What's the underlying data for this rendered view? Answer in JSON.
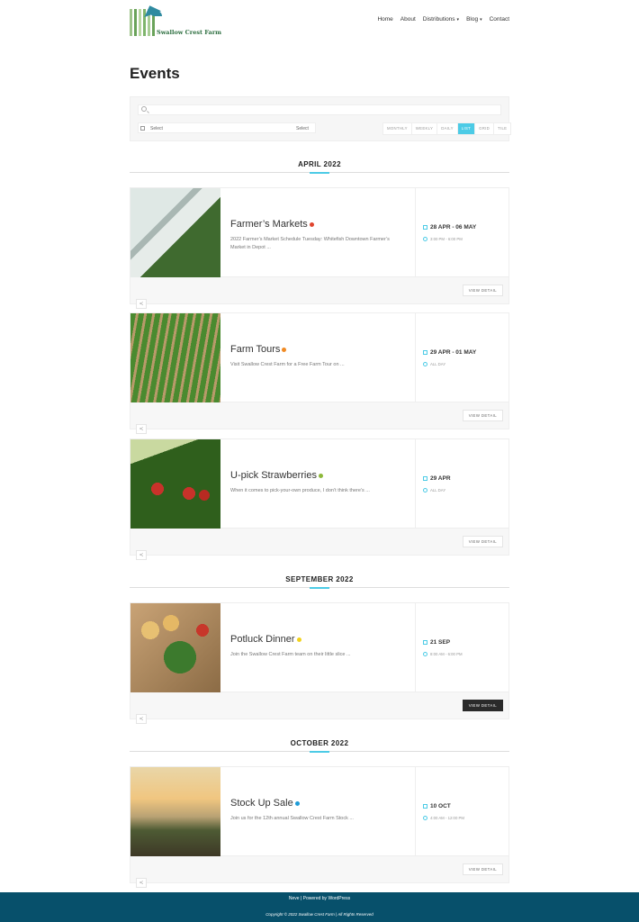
{
  "logo": {
    "text": "Swallow Crest Farm"
  },
  "nav": {
    "items": [
      "Home",
      "About",
      "Distributions",
      "Blog",
      "Contact"
    ]
  },
  "page": {
    "title": "Events"
  },
  "filter": {
    "select_label": "Select",
    "select_value": "Select",
    "views": [
      "MONTHLY",
      "WEEKLY",
      "DAILY",
      "LIST",
      "GRID",
      "TILE"
    ],
    "active_view": "LIST"
  },
  "months": [
    "APRIL 2022",
    "SEPTEMBER 2022",
    "OCTOBER 2022"
  ],
  "events": [
    {
      "title": "Farmer’s Markets",
      "dot_color": "#e0442e",
      "desc": "2022 Farmer’s Market Schedule Tuesday: Whitefish Downtown Farmer’s Market in Depot ...",
      "date": "28 APR - 06 MAY",
      "time": "3:00 PM - 6:00 PM",
      "button": "VIEW DETAIL"
    },
    {
      "title": "Farm Tours",
      "dot_color": "#f08a24",
      "desc": "Visit Swallow Crest Farm for a Free Farm Tour on ...",
      "date": "29 APR - 01 MAY",
      "time": "ALL DAY",
      "button": "VIEW DETAIL"
    },
    {
      "title": "U-pick Strawberries",
      "dot_color": "#8db83a",
      "desc": "When it comes to pick-your-own produce, I don’t think there’s ...",
      "date": "29 APR",
      "time": "ALL DAY",
      "button": "VIEW DETAIL"
    },
    {
      "title": "Potluck Dinner",
      "dot_color": "#f2d21c",
      "desc": "Join the Swallow Crest Farm team on their little slice ...",
      "date": "21 SEP",
      "time": "8:00 AM - 6:00 PM",
      "button": "VIEW DETAIL"
    },
    {
      "title": "Stock Up Sale",
      "dot_color": "#1e9bd7",
      "desc": "Join us for the 12th annual Swallow Crest Farm Stock ...",
      "date": "10 OCT",
      "time": "4:00 AM - 12:00 PM",
      "button": "VIEW DETAIL"
    }
  ],
  "footer": {
    "line1": "Neve | Powered by WordPress",
    "line2": "Copyright © 2022 Swallow Crest Farm | All Rights Reserved"
  }
}
